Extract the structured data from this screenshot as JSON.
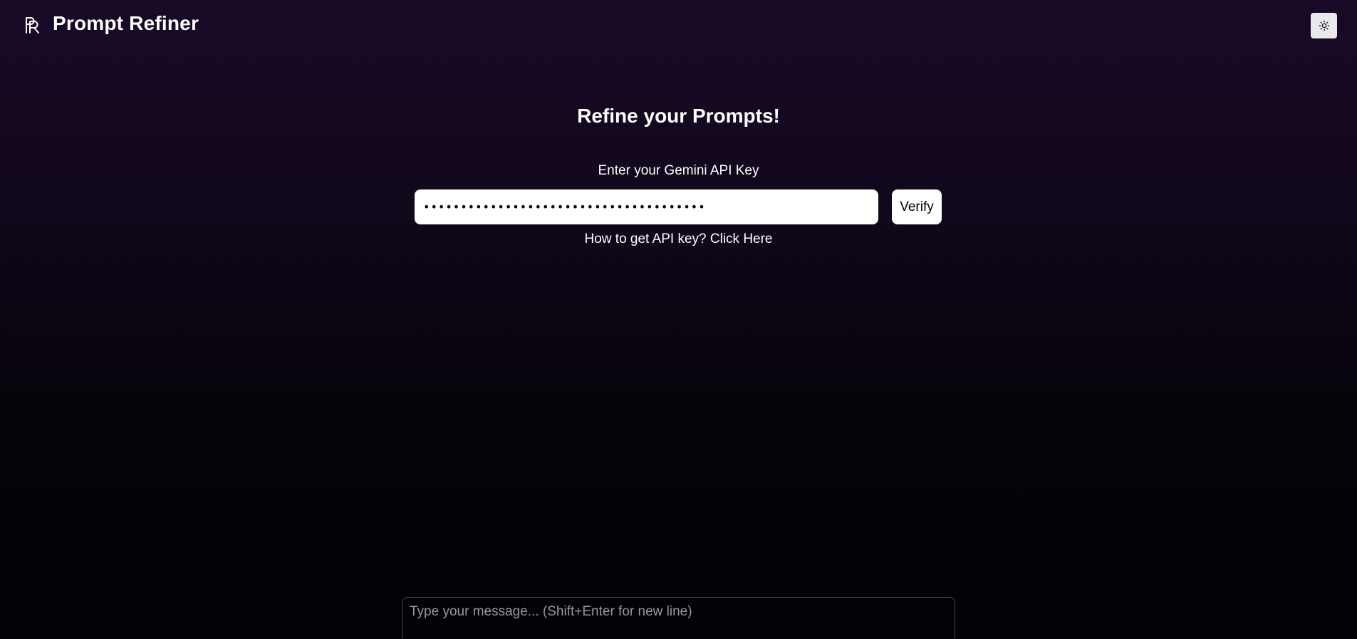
{
  "header": {
    "app_title": "Prompt Refiner",
    "logo_icon": "pr-monogram-icon",
    "theme_toggle_icon": "sun-icon"
  },
  "main": {
    "heading": "Refine your Prompts!",
    "api_key_label": "Enter your Gemini API Key",
    "api_key_value": "••••••••••••••••••••••••••••••••••••••",
    "verify_label": "Verify",
    "help_text": "How to get API key? Click Here"
  },
  "composer": {
    "placeholder": "Type your message... (Shift+Enter for new line)"
  },
  "colors": {
    "background_top": "#190a28",
    "background_bottom": "#020104",
    "toggle_bg": "#e9e8ec"
  }
}
